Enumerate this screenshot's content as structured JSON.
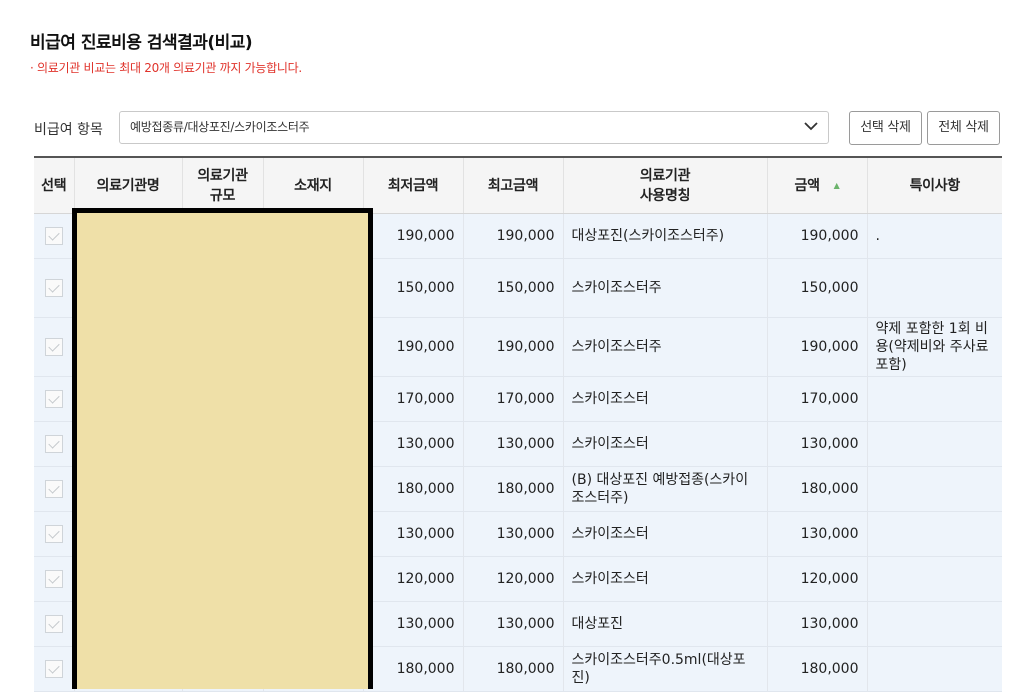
{
  "header": {
    "title": "비급여 진료비용 검색결과(비교)",
    "notice": "· 의료기관 비교는 최대 20개 의료기관 까지 가능합니다."
  },
  "filter": {
    "label": "비급여 항목",
    "selected": "예방접종류/대상포진/스카이조스터주",
    "select_button": "선택 삭제",
    "clear_button": "전체 삭제"
  },
  "table": {
    "columns": {
      "select": "선택",
      "name": "의료기관명",
      "size_1": "의료기관",
      "size_2": "규모",
      "location": "소재지",
      "min_price": "최저금액",
      "max_price": "최고금액",
      "use_name_1": "의료기관",
      "use_name_2": "사용명칭",
      "price": "금액",
      "note": "특이사항"
    },
    "rows": [
      {
        "min": "190,000",
        "max": "190,000",
        "use_name": "대상포진(스카이조스터주)",
        "price": "190,000",
        "note": "."
      },
      {
        "min": "150,000",
        "max": "150,000",
        "use_name": "스카이조스터주",
        "price": "150,000",
        "note": ""
      },
      {
        "min": "190,000",
        "max": "190,000",
        "use_name": "스카이조스터주",
        "price": "190,000",
        "note": "약제 포함한 1회 비용(약제비와 주사료 포함)"
      },
      {
        "min": "170,000",
        "max": "170,000",
        "use_name": "스카이조스터",
        "price": "170,000",
        "note": ""
      },
      {
        "min": "130,000",
        "max": "130,000",
        "use_name": "스카이조스터",
        "price": "130,000",
        "note": ""
      },
      {
        "min": "180,000",
        "max": "180,000",
        "use_name": "(B) 대상포진 예방접종(스카이조스터주)",
        "price": "180,000",
        "note": ""
      },
      {
        "min": "130,000",
        "max": "130,000",
        "use_name": "스카이조스터",
        "price": "130,000",
        "note": ""
      },
      {
        "min": "120,000",
        "max": "120,000",
        "use_name": "스카이조스터",
        "price": "120,000",
        "note": ""
      },
      {
        "min": "130,000",
        "max": "130,000",
        "use_name": "대상포진",
        "price": "130,000",
        "note": ""
      },
      {
        "min": "180,000",
        "max": "180,000",
        "use_name": "스카이조스터주0.5ml(대상포진)",
        "price": "180,000",
        "note": ""
      }
    ]
  },
  "colors": {
    "notice": "#e0332b",
    "row_bg": "#eef4fb",
    "redaction": "#efe0a8",
    "sort_icon": "#6bb36b"
  },
  "icons": {
    "dropdown": "chevron-down-icon",
    "sort": "sort-ascending-icon",
    "checkbox": "checkbox-icon"
  }
}
